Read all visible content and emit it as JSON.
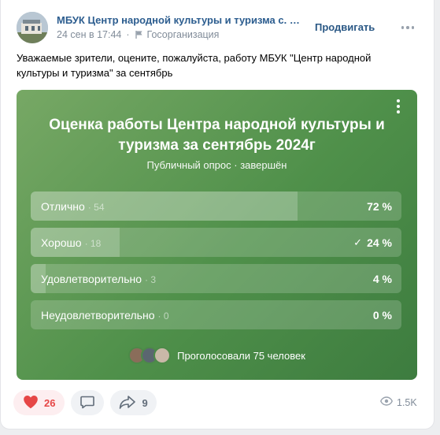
{
  "post": {
    "author": "МБУК Центр народной культуры и туризма с. Я...",
    "date": "24 сен в 17:44",
    "org_label": "Госорганизация",
    "promote_label": "Продвигать",
    "text": "Уважаемые зрители, оцените, пожалуйста, работу МБУК \"Центр народной культуры и туризма\" за сентябрь"
  },
  "poll": {
    "title": "Оценка работы Центра народной культуры и туризма за сентябрь 2024г",
    "subtitle": "Публичный опрос · завершён",
    "options": [
      {
        "label": "Отлично",
        "count": "54",
        "percent": "72 %",
        "share": 0.72,
        "checked": false
      },
      {
        "label": "Хорошо",
        "count": "18",
        "percent": "24 %",
        "share": 0.24,
        "checked": true
      },
      {
        "label": "Удовлетворительно",
        "count": "3",
        "percent": "4 %",
        "share": 0.04,
        "checked": false
      },
      {
        "label": "Неудовлетворительно",
        "count": "0",
        "percent": "0 %",
        "share": 0.0,
        "checked": false
      }
    ],
    "voters_text": "Проголосовали 75 человек"
  },
  "actions": {
    "likes": "26",
    "comments": "",
    "shares": "9",
    "views": "1.5K"
  },
  "colors": {
    "like": "#e64646",
    "author_link": "#2c5d8f",
    "poll_bg": "#4f904a"
  },
  "icons": {
    "flag": "flag-icon",
    "like": "heart-icon",
    "comment": "comment-icon",
    "share": "share-arrow-icon",
    "views": "eye-icon",
    "check": "checkmark-icon",
    "menu": "more-vertical-icon"
  }
}
